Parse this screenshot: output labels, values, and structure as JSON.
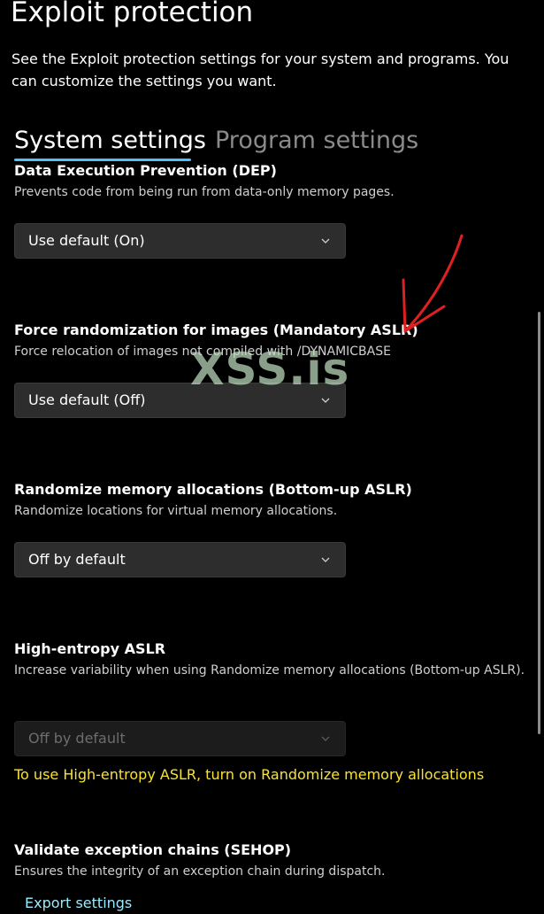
{
  "page": {
    "title": "Exploit protection",
    "description": "See the Exploit protection settings for your system and programs.  You can customize the settings you want."
  },
  "tabs": [
    {
      "label": "System settings",
      "selected": true
    },
    {
      "label": "Program settings",
      "selected": false
    }
  ],
  "sections": [
    {
      "title": "Data Execution Prevention (DEP)",
      "description": "Prevents code from being run from data-only memory pages.",
      "dropdown_value": "Use default (On)",
      "enabled": true
    },
    {
      "title": "Force randomization for images (Mandatory ASLR)",
      "description": "Force relocation of images not compiled with /DYNAMICBASE",
      "dropdown_value": "Use default (Off)",
      "enabled": true
    },
    {
      "title": "Randomize memory allocations (Bottom-up ASLR)",
      "description": "Randomize locations for virtual memory allocations.",
      "dropdown_value": "Off by default",
      "enabled": true
    },
    {
      "title": "High-entropy ASLR",
      "description": "Increase variability when using Randomize memory allocations (Bottom-up ASLR).",
      "dropdown_value": "Off by default",
      "enabled": false
    },
    {
      "title": "Validate exception chains (SEHOP)",
      "description": "Ensures the integrity of an exception chain during dispatch."
    }
  ],
  "warning": "To use High-entropy ASLR, turn on Randomize memory allocations",
  "links": {
    "export": "Export settings"
  },
  "overlay": {
    "watermark": "XSS.is",
    "annotation_arrow_color": "#e02020"
  },
  "colors": {
    "background": "#000000",
    "accent": "#4cc2ff",
    "warning": "#f9e231",
    "link": "#99ebff",
    "dropdown_bg": "#2d2d2d"
  },
  "icons": {
    "dropdown": "chevron-down-icon"
  }
}
